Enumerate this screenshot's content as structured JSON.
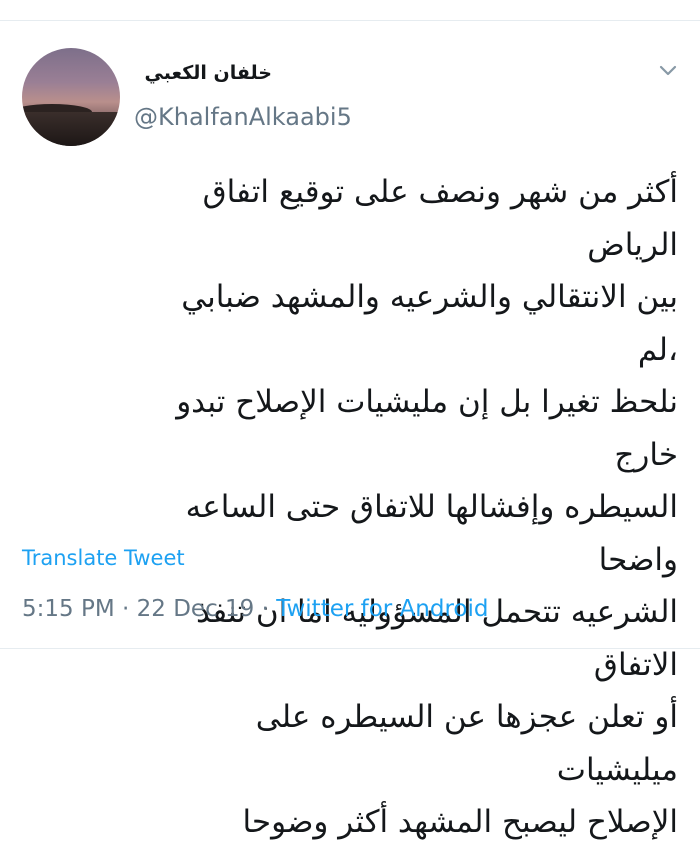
{
  "tweet": {
    "display_name": "خلفان الكعبي",
    "handle": "@KhalfanAlkaabi5",
    "text": "أكثر من شهر ونصف على توقيع اتفاق الرياض\nبين الانتقالي والشرعيه والمشهد ضبابي ،لم\nنلحظ تغيرا بل إن مليشيات الإصلاح تبدو خارج\nالسيطره وإفشالها للاتفاق حتى الساعه واضحا\nالشرعيه تتحمل المسؤوليه اما ان تنفذ الاتفاق\nأو تعلن عجزها عن السيطره على ميليشيات\nالإصلاح ليصبح المشهد أكثر وضوحا",
    "translate_label": "Translate Tweet",
    "time": "5:15 PM",
    "separator": "·",
    "date": "22 Dec 19",
    "source": "Twitter for Android"
  },
  "icons": {
    "menu": "chevron-down-icon",
    "avatar": "profile-photo"
  },
  "colors": {
    "link": "#1da1f2",
    "muted": "#657786",
    "text": "#14171a"
  }
}
